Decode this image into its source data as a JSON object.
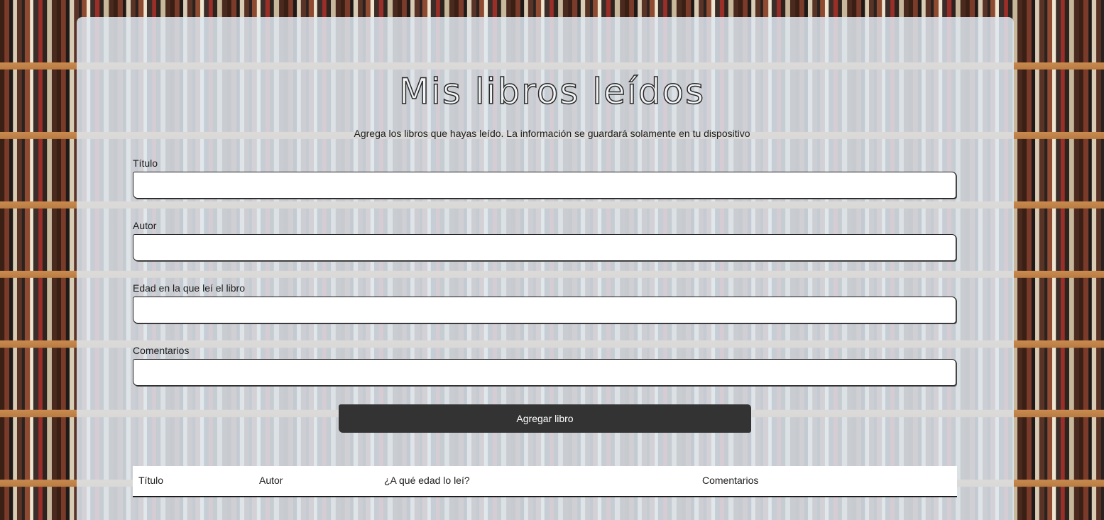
{
  "header": {
    "title": "Mis libros leídos",
    "subtitle": "Agrega los libros que hayas leído. La información se guardará solamente en tu dispositivo"
  },
  "form": {
    "fields": [
      {
        "label": "Título",
        "value": "",
        "placeholder": ""
      },
      {
        "label": "Autor",
        "value": "",
        "placeholder": ""
      },
      {
        "label": "Edad en la que leí el libro",
        "value": "",
        "placeholder": ""
      },
      {
        "label": "Comentarios",
        "value": "",
        "placeholder": ""
      }
    ],
    "submit_label": "Agregar libro"
  },
  "table": {
    "columns": [
      "Título",
      "Autor",
      "¿A qué edad lo leí?",
      "Comentarios"
    ],
    "rows": []
  }
}
